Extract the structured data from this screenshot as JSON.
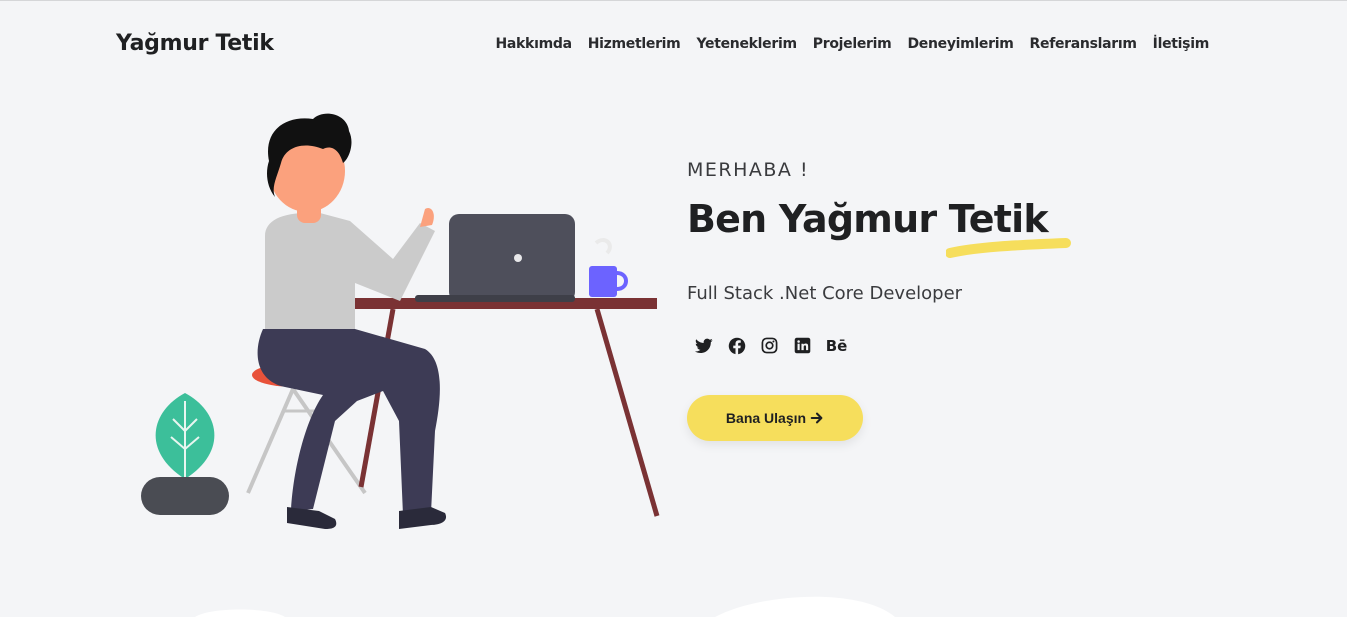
{
  "brand": {
    "name": "Yağmur Tetik"
  },
  "nav": {
    "items": [
      "Hakkımda",
      "Hizmetlerim",
      "Yeteneklerim",
      "Projelerim",
      "Deneyimlerim",
      "Referanslarım",
      "İletişim"
    ]
  },
  "hero": {
    "greeting": "MERHABA !",
    "headline_prefix": "Ben Yağmur ",
    "headline_highlight": "Tetik",
    "subtitle": "Full Stack .Net Core Developer",
    "cta_label": "Bana Ulaşın"
  },
  "socials": {
    "icons": [
      "twitter-icon",
      "facebook-icon",
      "instagram-icon",
      "linkedin-icon",
      "behance-icon"
    ],
    "behance_text": "Bē"
  },
  "colors": {
    "background": "#f4f5f7",
    "accent_yellow": "#f6de5c",
    "text_dark": "#1f2022"
  }
}
